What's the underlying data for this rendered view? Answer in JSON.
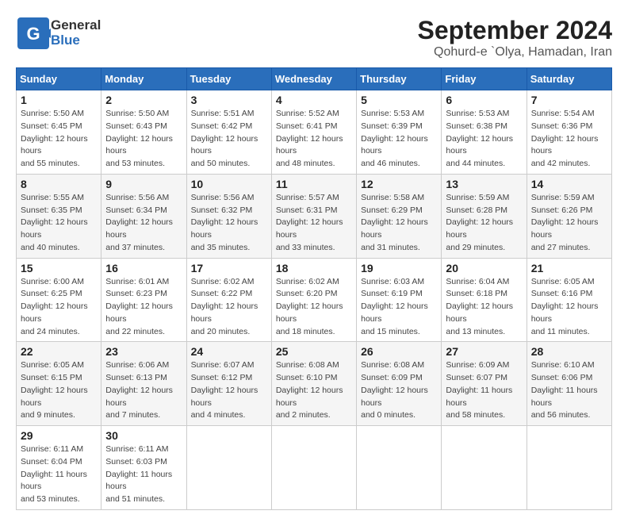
{
  "header": {
    "logo_general": "General",
    "logo_blue": "Blue",
    "month_title": "September 2024",
    "location": "Qohurd-e `Olya, Hamadan, Iran"
  },
  "weekdays": [
    "Sunday",
    "Monday",
    "Tuesday",
    "Wednesday",
    "Thursday",
    "Friday",
    "Saturday"
  ],
  "weeks": [
    [
      {
        "day": "1",
        "sunrise": "5:50 AM",
        "sunset": "6:45 PM",
        "daylight": "12 hours and 55 minutes."
      },
      {
        "day": "2",
        "sunrise": "5:50 AM",
        "sunset": "6:43 PM",
        "daylight": "12 hours and 53 minutes."
      },
      {
        "day": "3",
        "sunrise": "5:51 AM",
        "sunset": "6:42 PM",
        "daylight": "12 hours and 50 minutes."
      },
      {
        "day": "4",
        "sunrise": "5:52 AM",
        "sunset": "6:41 PM",
        "daylight": "12 hours and 48 minutes."
      },
      {
        "day": "5",
        "sunrise": "5:53 AM",
        "sunset": "6:39 PM",
        "daylight": "12 hours and 46 minutes."
      },
      {
        "day": "6",
        "sunrise": "5:53 AM",
        "sunset": "6:38 PM",
        "daylight": "12 hours and 44 minutes."
      },
      {
        "day": "7",
        "sunrise": "5:54 AM",
        "sunset": "6:36 PM",
        "daylight": "12 hours and 42 minutes."
      }
    ],
    [
      {
        "day": "8",
        "sunrise": "5:55 AM",
        "sunset": "6:35 PM",
        "daylight": "12 hours and 40 minutes."
      },
      {
        "day": "9",
        "sunrise": "5:56 AM",
        "sunset": "6:34 PM",
        "daylight": "12 hours and 37 minutes."
      },
      {
        "day": "10",
        "sunrise": "5:56 AM",
        "sunset": "6:32 PM",
        "daylight": "12 hours and 35 minutes."
      },
      {
        "day": "11",
        "sunrise": "5:57 AM",
        "sunset": "6:31 PM",
        "daylight": "12 hours and 33 minutes."
      },
      {
        "day": "12",
        "sunrise": "5:58 AM",
        "sunset": "6:29 PM",
        "daylight": "12 hours and 31 minutes."
      },
      {
        "day": "13",
        "sunrise": "5:59 AM",
        "sunset": "6:28 PM",
        "daylight": "12 hours and 29 minutes."
      },
      {
        "day": "14",
        "sunrise": "5:59 AM",
        "sunset": "6:26 PM",
        "daylight": "12 hours and 27 minutes."
      }
    ],
    [
      {
        "day": "15",
        "sunrise": "6:00 AM",
        "sunset": "6:25 PM",
        "daylight": "12 hours and 24 minutes."
      },
      {
        "day": "16",
        "sunrise": "6:01 AM",
        "sunset": "6:23 PM",
        "daylight": "12 hours and 22 minutes."
      },
      {
        "day": "17",
        "sunrise": "6:02 AM",
        "sunset": "6:22 PM",
        "daylight": "12 hours and 20 minutes."
      },
      {
        "day": "18",
        "sunrise": "6:02 AM",
        "sunset": "6:20 PM",
        "daylight": "12 hours and 18 minutes."
      },
      {
        "day": "19",
        "sunrise": "6:03 AM",
        "sunset": "6:19 PM",
        "daylight": "12 hours and 15 minutes."
      },
      {
        "day": "20",
        "sunrise": "6:04 AM",
        "sunset": "6:18 PM",
        "daylight": "12 hours and 13 minutes."
      },
      {
        "day": "21",
        "sunrise": "6:05 AM",
        "sunset": "6:16 PM",
        "daylight": "12 hours and 11 minutes."
      }
    ],
    [
      {
        "day": "22",
        "sunrise": "6:05 AM",
        "sunset": "6:15 PM",
        "daylight": "12 hours and 9 minutes."
      },
      {
        "day": "23",
        "sunrise": "6:06 AM",
        "sunset": "6:13 PM",
        "daylight": "12 hours and 7 minutes."
      },
      {
        "day": "24",
        "sunrise": "6:07 AM",
        "sunset": "6:12 PM",
        "daylight": "12 hours and 4 minutes."
      },
      {
        "day": "25",
        "sunrise": "6:08 AM",
        "sunset": "6:10 PM",
        "daylight": "12 hours and 2 minutes."
      },
      {
        "day": "26",
        "sunrise": "6:08 AM",
        "sunset": "6:09 PM",
        "daylight": "12 hours and 0 minutes."
      },
      {
        "day": "27",
        "sunrise": "6:09 AM",
        "sunset": "6:07 PM",
        "daylight": "11 hours and 58 minutes."
      },
      {
        "day": "28",
        "sunrise": "6:10 AM",
        "sunset": "6:06 PM",
        "daylight": "11 hours and 56 minutes."
      }
    ],
    [
      {
        "day": "29",
        "sunrise": "6:11 AM",
        "sunset": "6:04 PM",
        "daylight": "11 hours and 53 minutes."
      },
      {
        "day": "30",
        "sunrise": "6:11 AM",
        "sunset": "6:03 PM",
        "daylight": "11 hours and 51 minutes."
      },
      null,
      null,
      null,
      null,
      null
    ]
  ]
}
